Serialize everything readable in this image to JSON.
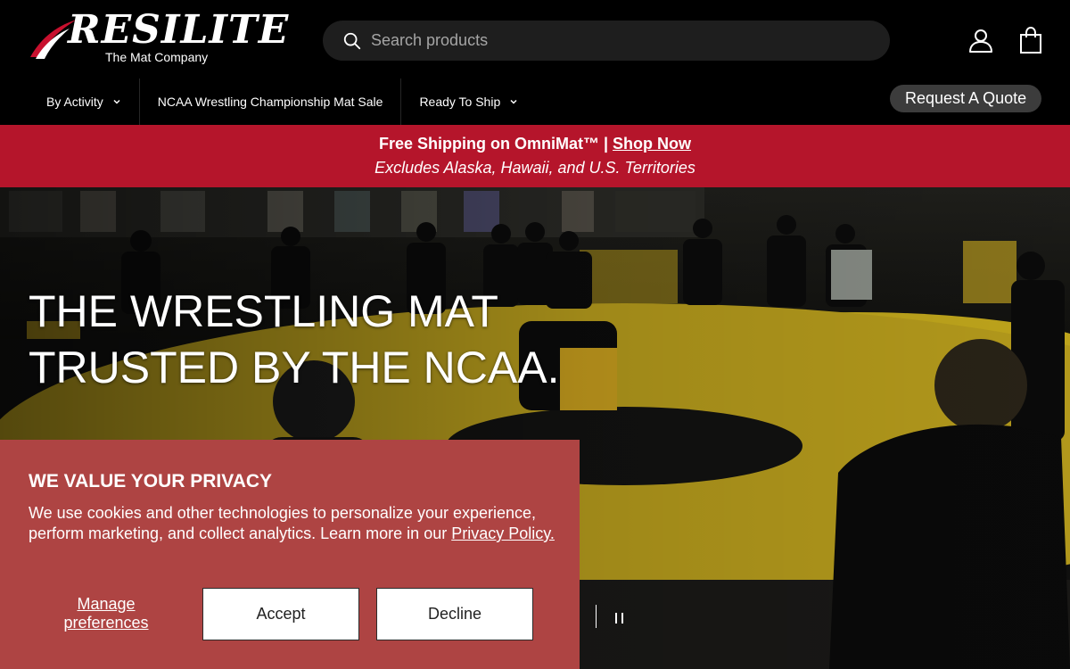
{
  "brand": {
    "name": "RESILITE",
    "tagline": "The Mat Company",
    "accent": "#b5152b"
  },
  "search": {
    "placeholder": "Search products",
    "icon": "search-icon"
  },
  "header_icons": {
    "account": "user-icon",
    "cart": "bag-icon"
  },
  "nav": {
    "items": [
      {
        "label": "By Activity",
        "has_dropdown": true
      },
      {
        "label": "NCAA Wrestling Championship Mat Sale",
        "has_dropdown": false
      },
      {
        "label": "Ready To Ship",
        "has_dropdown": true
      }
    ],
    "quote_button": "Request A Quote"
  },
  "announcement": {
    "prefix": "Free Shipping on OmniMat™ | ",
    "link": "Shop Now",
    "subtext": "Excludes Alaska, Hawaii, and U.S. Territories"
  },
  "hero": {
    "title": "THE WRESTLING MAT TRUSTED BY THE NCAA.",
    "pause_icon": "pause-icon"
  },
  "cookie": {
    "title": "WE VALUE YOUR PRIVACY",
    "body": "We use cookies and other technologies to personalize your experience, perform marketing, and collect analytics. Learn more in our ",
    "policy_link": "Privacy Policy.",
    "manage": "Manage preferences",
    "accept": "Accept",
    "decline": "Decline"
  }
}
